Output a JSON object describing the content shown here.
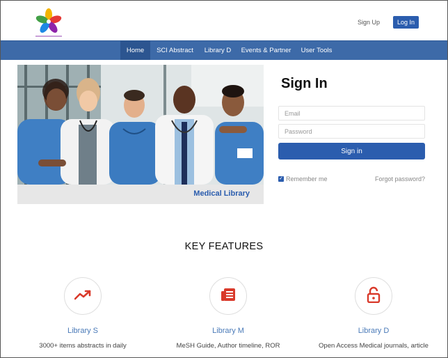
{
  "header": {
    "logo_icon": "flower-logo-icon",
    "signup_label": "Sign Up",
    "login_label": "Log In"
  },
  "nav": {
    "items": [
      {
        "label": "Home",
        "active": true
      },
      {
        "label": "SCI Abstract",
        "active": false
      },
      {
        "label": "Library D",
        "active": false
      },
      {
        "label": "Events & Partner",
        "active": false
      },
      {
        "label": "User Tools",
        "active": false
      }
    ]
  },
  "hero": {
    "caption": "Medical Library"
  },
  "signin": {
    "title": "Sign In",
    "email_placeholder": "Email",
    "password_placeholder": "Password",
    "button_label": "Sign in",
    "remember_label": "Remember me",
    "remember_checked": true,
    "forgot_label": "Forgot password?"
  },
  "features": {
    "title": "KEY FEATURES",
    "items": [
      {
        "icon": "trending-up-icon",
        "name": "Library S",
        "desc": "3000+ items abstracts in daily"
      },
      {
        "icon": "newspaper-icon",
        "name": "Library M",
        "desc": "MeSH Guide, Author timeline, ROR"
      },
      {
        "icon": "unlock-icon",
        "name": "Library D",
        "desc": "Open Access Medical journals, article"
      }
    ]
  },
  "colors": {
    "brand_blue": "#2b5dae",
    "nav_blue": "#3d6aa8",
    "feature_icon_red": "#d93a2b"
  }
}
